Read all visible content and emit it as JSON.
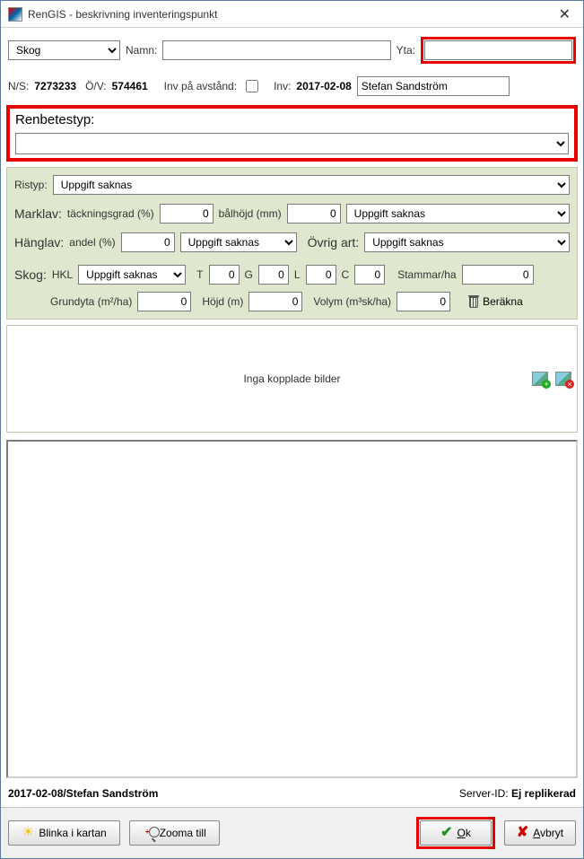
{
  "window": {
    "title": "RenGIS - beskrivning inventeringspunkt"
  },
  "top": {
    "category": "Skog",
    "namn_label": "Namn:",
    "namn_value": "",
    "yta_label": "Yta:",
    "yta_value": "",
    "ns_label": "N/S:",
    "ns_value": "7273233",
    "ov_label": "Ö/V:",
    "ov_value": "574461",
    "inv_avstand_label": "Inv på avstånd:",
    "inv_label": "Inv:",
    "inv_date": "2017-02-08",
    "inv_person": "Stefan Sandström"
  },
  "renbetestyp": {
    "label": "Renbetestyp:",
    "value": ""
  },
  "ristyp": {
    "label": "Ristyp:",
    "value": "Uppgift saknas"
  },
  "marklav": {
    "label": "Marklav:",
    "tg_label": "täckningsgrad (%)",
    "tg_value": "0",
    "balhojd_label": "bålhöjd (mm)",
    "balhojd_value": "0",
    "status": "Uppgift saknas"
  },
  "hanglav": {
    "label": "Hänglav:",
    "andel_label": "andel (%)",
    "andel_value": "0",
    "status": "Uppgift saknas",
    "ovrig_label": "Övrig art:",
    "ovrig_value": "Uppgift saknas"
  },
  "skog": {
    "label": "Skog:",
    "hkl_label": "HKL",
    "hkl_value": "Uppgift saknas",
    "t_label": "T",
    "t_value": "0",
    "g_label": "G",
    "g_value": "0",
    "l_label": "L",
    "l_value": "0",
    "c_label": "C",
    "c_value": "0",
    "stammar_label": "Stammar/ha",
    "stammar_value": "0",
    "grundyta_label": "Grundyta (m²/ha)",
    "grundyta_value": "0",
    "hojd_label": "Höjd (m)",
    "hojd_value": "0",
    "volym_label": "Volym (m³sk/ha)",
    "volym_value": "0",
    "berakna_label": "Beräkna"
  },
  "images": {
    "empty_label": "Inga kopplade bilder"
  },
  "status": {
    "left": "2017-02-08/Stefan Sandström",
    "server_label": "Server-ID:",
    "server_value": "Ej replikerad"
  },
  "buttons": {
    "blinka": "Blinka i kartan",
    "zooma": "Zooma till",
    "ok": "Ok",
    "avbryt": "Avbryt"
  }
}
